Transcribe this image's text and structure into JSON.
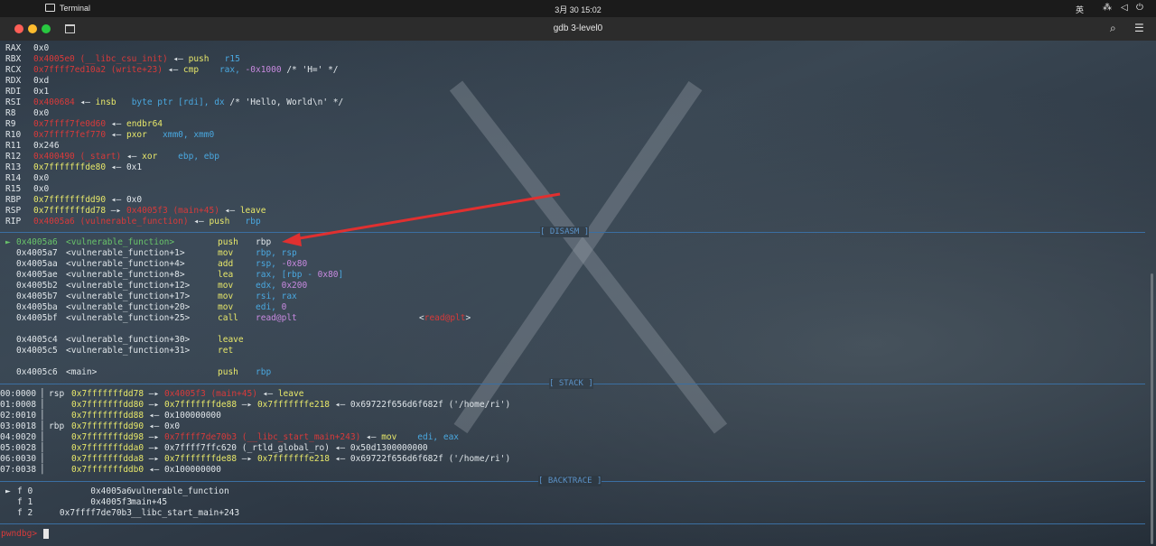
{
  "topbar": {
    "app_name": "Terminal",
    "clock": "3月 30  15:02",
    "ime": "英"
  },
  "window": {
    "title": "gdb 3-level0"
  },
  "registers": [
    {
      "name": "RAX",
      "parts": [
        {
          "t": "0x0",
          "c": "w"
        }
      ]
    },
    {
      "name": "RBX",
      "parts": [
        {
          "t": "0x4005e0 (__libc_csu_init)",
          "c": "r"
        },
        {
          "t": " ◂— ",
          "c": "w"
        },
        {
          "t": "push",
          "c": "y"
        },
        {
          "t": "   r15",
          "c": "b"
        }
      ]
    },
    {
      "name": "RCX",
      "parts": [
        {
          "t": "0x7ffff7ed10a2 (write+23)",
          "c": "r"
        },
        {
          "t": " ◂— ",
          "c": "w"
        },
        {
          "t": "cmp",
          "c": "y"
        },
        {
          "t": "    rax, ",
          "c": "b"
        },
        {
          "t": "-0x1000",
          "c": "p"
        },
        {
          "t": " /* 'H=' */",
          "c": "w"
        }
      ]
    },
    {
      "name": "RDX",
      "parts": [
        {
          "t": "0xd",
          "c": "w"
        }
      ]
    },
    {
      "name": "RDI",
      "parts": [
        {
          "t": "0x1",
          "c": "w"
        }
      ]
    },
    {
      "name": "RSI",
      "parts": [
        {
          "t": "0x400684",
          "c": "r"
        },
        {
          "t": " ◂— ",
          "c": "w"
        },
        {
          "t": "insb",
          "c": "y"
        },
        {
          "t": "   byte ptr [rdi], dx",
          "c": "b"
        },
        {
          "t": " /* 'Hello, World\\n' */",
          "c": "w"
        }
      ]
    },
    {
      "name": "R8",
      "parts": [
        {
          "t": "0x0",
          "c": "w"
        }
      ]
    },
    {
      "name": "R9",
      "parts": [
        {
          "t": "0x7ffff7fe0d60",
          "c": "r"
        },
        {
          "t": " ◂— ",
          "c": "w"
        },
        {
          "t": "endbr64",
          "c": "y"
        }
      ]
    },
    {
      "name": "R10",
      "parts": [
        {
          "t": "0x7ffff7fef770",
          "c": "r"
        },
        {
          "t": " ◂— ",
          "c": "w"
        },
        {
          "t": "pxor",
          "c": "y"
        },
        {
          "t": "   xmm0, xmm0",
          "c": "b"
        }
      ]
    },
    {
      "name": "R11",
      "parts": [
        {
          "t": "0x246",
          "c": "w"
        }
      ]
    },
    {
      "name": "R12",
      "parts": [
        {
          "t": "0x400490 (_start)",
          "c": "r"
        },
        {
          "t": " ◂— ",
          "c": "w"
        },
        {
          "t": "xor",
          "c": "y"
        },
        {
          "t": "    ebp, ebp",
          "c": "b"
        }
      ]
    },
    {
      "name": "R13",
      "parts": [
        {
          "t": "0x7fffffffde80",
          "c": "y"
        },
        {
          "t": " ◂— 0x1",
          "c": "w"
        }
      ]
    },
    {
      "name": "R14",
      "parts": [
        {
          "t": "0x0",
          "c": "w"
        }
      ]
    },
    {
      "name": "R15",
      "parts": [
        {
          "t": "0x0",
          "c": "w"
        }
      ]
    },
    {
      "name": "RBP",
      "parts": [
        {
          "t": "0x7fffffffdd90",
          "c": "y"
        },
        {
          "t": " ◂— 0x0",
          "c": "w"
        }
      ]
    },
    {
      "name": "RSP",
      "parts": [
        {
          "t": "0x7fffffffdd78",
          "c": "y"
        },
        {
          "t": " —▸ ",
          "c": "w"
        },
        {
          "t": "0x4005f3 (main+45)",
          "c": "r"
        },
        {
          "t": " ◂— ",
          "c": "w"
        },
        {
          "t": "leave",
          "c": "y"
        }
      ]
    },
    {
      "name": "RIP",
      "parts": [
        {
          "t": "0x4005a6 (vulnerable_function)",
          "c": "r"
        },
        {
          "t": " ◂— ",
          "c": "w"
        },
        {
          "t": "push",
          "c": "y"
        },
        {
          "t": "   rbp",
          "c": "b"
        }
      ]
    }
  ],
  "sections": {
    "disasm": "[ DISASM ]",
    "stack": "[ STACK ]",
    "backtrace": "[ BACKTRACE ]"
  },
  "disasm": [
    {
      "marker": "►",
      "addr": "0x4005a6",
      "sym": "<vulnerable_function>",
      "op": "push",
      "args": [
        {
          "t": "rbp",
          "c": "w"
        }
      ],
      "current": true
    },
    {
      "marker": "",
      "addr": "0x4005a7",
      "sym": "<vulnerable_function+1>",
      "op": "mov",
      "args": [
        {
          "t": "rbp, rsp",
          "c": "b"
        }
      ]
    },
    {
      "marker": "",
      "addr": "0x4005aa",
      "sym": "<vulnerable_function+4>",
      "op": "add",
      "args": [
        {
          "t": "rsp, ",
          "c": "b"
        },
        {
          "t": "-0x80",
          "c": "p"
        }
      ]
    },
    {
      "marker": "",
      "addr": "0x4005ae",
      "sym": "<vulnerable_function+8>",
      "op": "lea",
      "args": [
        {
          "t": "rax, [rbp - ",
          "c": "b"
        },
        {
          "t": "0x80",
          "c": "p"
        },
        {
          "t": "]",
          "c": "b"
        }
      ]
    },
    {
      "marker": "",
      "addr": "0x4005b2",
      "sym": "<vulnerable_function+12>",
      "op": "mov",
      "args": [
        {
          "t": "edx, ",
          "c": "b"
        },
        {
          "t": "0x200",
          "c": "p"
        }
      ]
    },
    {
      "marker": "",
      "addr": "0x4005b7",
      "sym": "<vulnerable_function+17>",
      "op": "mov",
      "args": [
        {
          "t": "rsi, rax",
          "c": "b"
        }
      ]
    },
    {
      "marker": "",
      "addr": "0x4005ba",
      "sym": "<vulnerable_function+20>",
      "op": "mov",
      "args": [
        {
          "t": "edi, ",
          "c": "b"
        },
        {
          "t": "0",
          "c": "p"
        }
      ]
    },
    {
      "marker": "",
      "addr": "0x4005bf",
      "sym": "<vulnerable_function+25>",
      "op": "call",
      "args": [
        {
          "t": "read@plt",
          "c": "p"
        }
      ],
      "note": [
        {
          "t": "<",
          "c": "w"
        },
        {
          "t": "read@plt",
          "c": "r"
        },
        {
          "t": ">",
          "c": "w"
        }
      ]
    },
    {
      "blank": true
    },
    {
      "marker": "",
      "addr": "0x4005c4",
      "sym": "<vulnerable_function+30>",
      "op": "leave",
      "args": []
    },
    {
      "marker": "",
      "addr": "0x4005c5",
      "sym": "<vulnerable_function+31>",
      "op": "ret",
      "args": []
    },
    {
      "blank": true
    },
    {
      "marker": "",
      "addr": "0x4005c6",
      "sym": "<main>",
      "op": "push",
      "args": [
        {
          "t": "rbp",
          "c": "b"
        }
      ]
    }
  ],
  "stack": [
    {
      "off": "00:0000",
      "reg": "rsp",
      "parts": [
        {
          "t": "0x7fffffffdd78",
          "c": "y"
        },
        {
          "t": " —▸ ",
          "c": "w"
        },
        {
          "t": "0x4005f3 (main+45)",
          "c": "r"
        },
        {
          "t": " ◂— ",
          "c": "w"
        },
        {
          "t": "leave",
          "c": "y"
        }
      ]
    },
    {
      "off": "01:0008",
      "reg": "",
      "parts": [
        {
          "t": "0x7fffffffdd80",
          "c": "y"
        },
        {
          "t": " —▸ ",
          "c": "w"
        },
        {
          "t": "0x7fffffffde88",
          "c": "y"
        },
        {
          "t": " —▸ ",
          "c": "w"
        },
        {
          "t": "0x7fffffffe218",
          "c": "y"
        },
        {
          "t": " ◂— 0x69722f656d6f682f ('/home/ri')",
          "c": "w"
        }
      ]
    },
    {
      "off": "02:0010",
      "reg": "",
      "parts": [
        {
          "t": "0x7fffffffdd88",
          "c": "y"
        },
        {
          "t": " ◂— 0x100000000",
          "c": "w"
        }
      ]
    },
    {
      "off": "03:0018",
      "reg": "rbp",
      "parts": [
        {
          "t": "0x7fffffffdd90",
          "c": "y"
        },
        {
          "t": " ◂— 0x0",
          "c": "w"
        }
      ]
    },
    {
      "off": "04:0020",
      "reg": "",
      "parts": [
        {
          "t": "0x7fffffffdd98",
          "c": "y"
        },
        {
          "t": " —▸ ",
          "c": "w"
        },
        {
          "t": "0x7ffff7de70b3 (__libc_start_main+243)",
          "c": "r"
        },
        {
          "t": " ◂— ",
          "c": "w"
        },
        {
          "t": "mov",
          "c": "y"
        },
        {
          "t": "    edi, eax",
          "c": "b"
        }
      ]
    },
    {
      "off": "05:0028",
      "reg": "",
      "parts": [
        {
          "t": "0x7fffffffdda0",
          "c": "y"
        },
        {
          "t": " —▸ 0x7ffff7ffc620 (_rtld_global_ro) ◂— 0x50d1300000000",
          "c": "w"
        }
      ]
    },
    {
      "off": "06:0030",
      "reg": "",
      "parts": [
        {
          "t": "0x7fffffffdda8",
          "c": "y"
        },
        {
          "t": " —▸ ",
          "c": "w"
        },
        {
          "t": "0x7fffffffde88",
          "c": "y"
        },
        {
          "t": " —▸ ",
          "c": "w"
        },
        {
          "t": "0x7fffffffe218",
          "c": "y"
        },
        {
          "t": " ◂— 0x69722f656d6f682f ('/home/ri')",
          "c": "w"
        }
      ]
    },
    {
      "off": "07:0038",
      "reg": "",
      "parts": [
        {
          "t": "0x7fffffffddb0",
          "c": "y"
        },
        {
          "t": " ◂— 0x100000000",
          "c": "w"
        }
      ]
    }
  ],
  "backtrace": [
    {
      "marker": "►",
      "frame": "f 0",
      "addr": "0x4005a6",
      "sym": "vulnerable_function"
    },
    {
      "marker": "",
      "frame": "f 1",
      "addr": "0x4005f3",
      "sym": "main+45"
    },
    {
      "marker": "",
      "frame": "f 2",
      "addr": "0x7ffff7de70b3",
      "sym": "__libc_start_main+243"
    }
  ],
  "prompt": "pwndbg>",
  "colors": {
    "yellow": "#e8e86a",
    "red": "#d83a3a",
    "green": "#69c46a",
    "blue": "#4aa8e0",
    "purple": "#c98ae0",
    "section": "#5c93c9",
    "arrow": "#e03030"
  }
}
